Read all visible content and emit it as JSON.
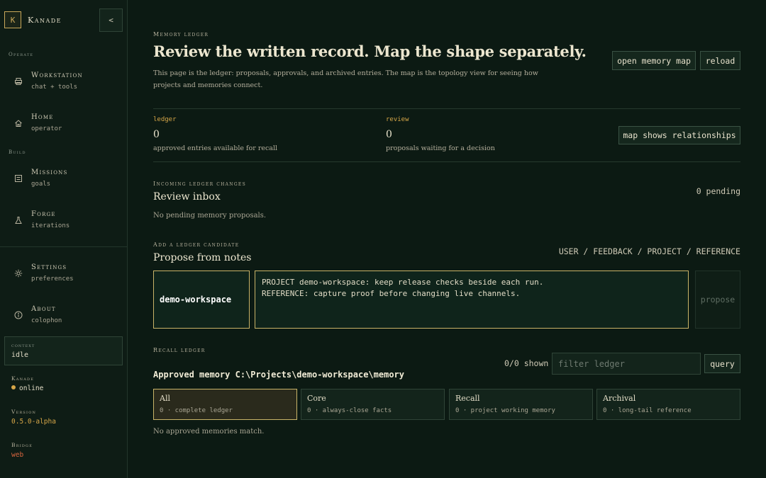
{
  "brand": {
    "mark": "K",
    "name": "Kanade",
    "collapse": "<"
  },
  "sidebar": {
    "sections": {
      "operate": "Operate",
      "build": "Build"
    },
    "items": [
      {
        "title": "Workstation",
        "sub": "chat + tools",
        "icon": "printer-icon"
      },
      {
        "title": "Home",
        "sub": "operator",
        "icon": "home-icon"
      },
      {
        "title": "Missions",
        "sub": "goals",
        "icon": "list-icon"
      },
      {
        "title": "Forge",
        "sub": "iterations",
        "icon": "flask-icon"
      },
      {
        "title": "Settings",
        "sub": "preferences",
        "icon": "gear-icon"
      },
      {
        "title": "About",
        "sub": "colophon",
        "icon": "info-icon"
      }
    ],
    "context": {
      "label": "context",
      "value": "idle"
    },
    "meta": [
      {
        "label": "Kanade",
        "value": "online",
        "color": "#e2dcc6"
      },
      {
        "label": "Version",
        "value": "0.5.0-alpha",
        "color": "#d6a648"
      },
      {
        "label": "Bridge",
        "value": "web",
        "color": "#d9663f"
      }
    ]
  },
  "header": {
    "kicker": "Memory ledger",
    "title": "Review the written record. Map the shape separately.",
    "lede": "This page is the ledger: proposals, approvals, and archived entries. The map is the topology view for seeing how projects and memories connect.",
    "open_map": "open memory map",
    "reload": "reload"
  },
  "stats": {
    "ledger": {
      "label": "ledger",
      "value": "0",
      "desc": "approved entries available for recall"
    },
    "review": {
      "label": "review",
      "value": "0",
      "desc": "proposals waiting for a decision"
    },
    "map_button": "map shows relationships"
  },
  "inbox": {
    "kicker": "Incoming ledger changes",
    "title": "Review inbox",
    "pending": "0 pending",
    "empty": "No pending memory proposals."
  },
  "propose": {
    "kicker": "Add a ledger candidate",
    "title": "Propose from notes",
    "kinds": "USER / FEEDBACK / PROJECT / REFERENCE",
    "project": "demo-workspace",
    "notes": "PROJECT demo-workspace: keep release checks beside each run.\nREFERENCE: capture proof before changing live channels.",
    "button": "propose"
  },
  "recall": {
    "kicker": "Recall ledger",
    "shown": "0/0 shown",
    "filter_placeholder": "filter ledger",
    "query": "query",
    "tooltip": "Approved memory C:\\Projects\\demo-workspace\\memory",
    "tiers": [
      {
        "name": "All",
        "sub": "0 · complete ledger",
        "active": true
      },
      {
        "name": "Core",
        "sub": "0 · always-close facts",
        "active": false
      },
      {
        "name": "Recall",
        "sub": "0 · project working memory",
        "active": false
      },
      {
        "name": "Archival",
        "sub": "0 · long-tail reference",
        "active": false
      }
    ],
    "empty": "No approved memories match."
  }
}
